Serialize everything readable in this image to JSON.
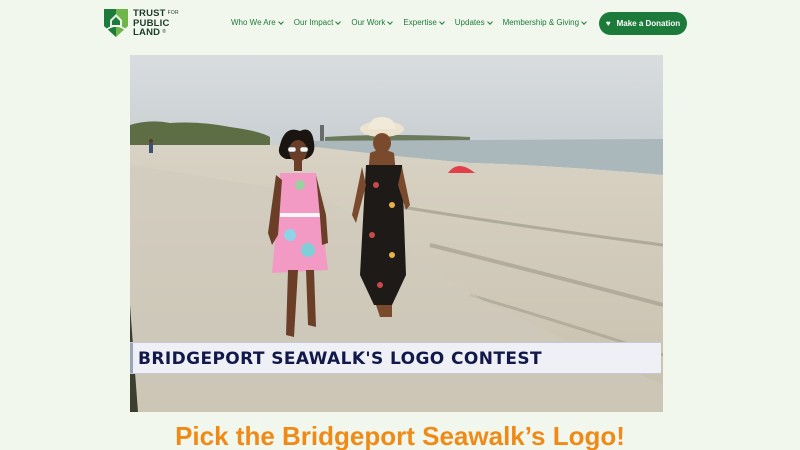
{
  "brand": {
    "line1": "TRUST",
    "line1_suffix": "FOR",
    "line2": "PUBLIC",
    "line3": "LAND",
    "line3_mark": "®",
    "colors": {
      "dark_green": "#1c7a3a",
      "light_green": "#6fb54a",
      "text": "#1d3b2a"
    }
  },
  "nav": {
    "items": [
      {
        "label": "Who We Are"
      },
      {
        "label": "Our Impact"
      },
      {
        "label": "Our Work"
      },
      {
        "label": "Expertise"
      },
      {
        "label": "Updates"
      },
      {
        "label": "Membership & Giving"
      }
    ],
    "dropdown_icon": "chevron-down-icon"
  },
  "donate_button": {
    "label": "Make a Donation",
    "icon": "heart-icon",
    "color": "#1c7a3a"
  },
  "hero": {
    "banner_text": "BRIDGEPORT SEAWALK'S LOGO CONTEST"
  },
  "headline": {
    "text": "Pick the Bridgeport Seawalk’s Logo!",
    "color": "#f08a17"
  },
  "page_background": "#f1f7ed"
}
